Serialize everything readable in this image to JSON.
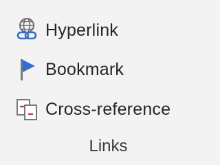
{
  "links_group": {
    "commands": [
      {
        "label": "Hyperlink",
        "icon": "hyperlink-globe-chain-icon"
      },
      {
        "label": "Bookmark",
        "icon": "bookmark-flag-icon"
      },
      {
        "label": "Cross-reference",
        "icon": "cross-reference-icon"
      }
    ],
    "group_label": "Links",
    "colors": {
      "background": "#f3f3f3",
      "text": "#262626",
      "icon_blue": "#2e6fd1",
      "icon_red": "#d13438",
      "icon_gray": "#6b6b6b"
    }
  }
}
